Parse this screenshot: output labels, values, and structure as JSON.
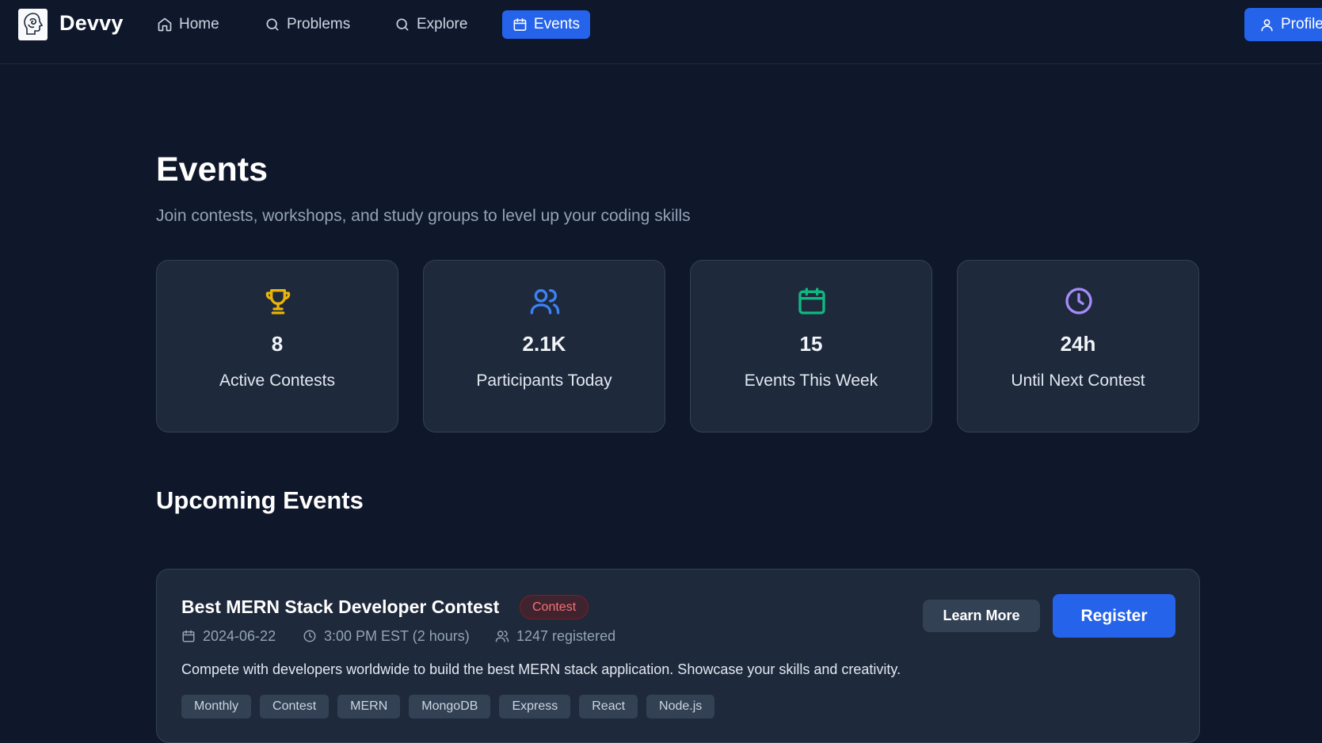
{
  "app": {
    "name": "Devvy"
  },
  "nav": {
    "items": [
      {
        "label": "Home",
        "icon": "home-icon"
      },
      {
        "label": "Problems",
        "icon": "search-icon"
      },
      {
        "label": "Explore",
        "icon": "search-icon"
      },
      {
        "label": "Events",
        "icon": "calendar-icon",
        "active": true
      }
    ],
    "profile_label": "Profile",
    "accent_color": "#2563eb"
  },
  "page": {
    "title": "Events",
    "subtitle": "Join contests, workshops, and study groups to level up your coding skills"
  },
  "stats": [
    {
      "value": "8",
      "label": "Active Contests",
      "icon": "trophy-icon",
      "color": "#eab308"
    },
    {
      "value": "2.1K",
      "label": "Participants Today",
      "icon": "users-icon",
      "color": "#3b82f6"
    },
    {
      "value": "15",
      "label": "Events This Week",
      "icon": "calendar-icon",
      "color": "#10b981"
    },
    {
      "value": "24h",
      "label": "Until Next Contest",
      "icon": "clock-icon",
      "color": "#a78bfa"
    }
  ],
  "upcoming": {
    "title": "Upcoming Events",
    "events": [
      {
        "title": "Best MERN Stack Developer Contest",
        "badge": "Contest",
        "date": "2024-06-22",
        "time": "3:00 PM EST (2 hours)",
        "registered": "1247 registered",
        "description": "Compete with developers worldwide to build the best MERN stack application. Showcase your skills and creativity.",
        "tags": [
          "Monthly",
          "Contest",
          "MERN",
          "MongoDB",
          "Express",
          "React",
          "Node.js"
        ],
        "learn_more_label": "Learn More",
        "register_label": "Register"
      }
    ]
  }
}
